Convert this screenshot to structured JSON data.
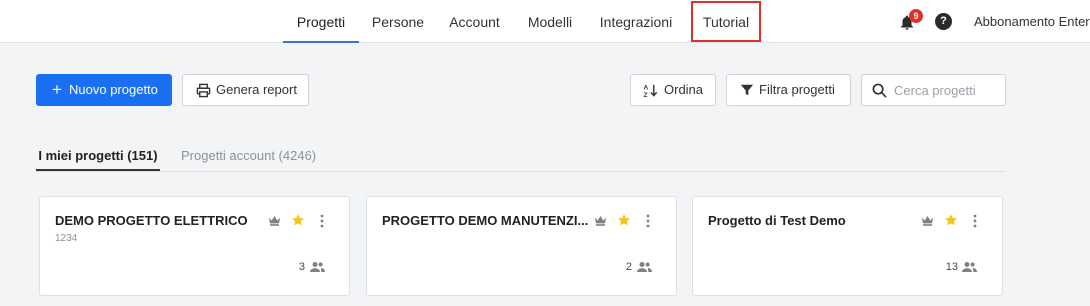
{
  "nav": {
    "items": [
      {
        "label": "Progetti",
        "active": true
      },
      {
        "label": "Persone",
        "active": false
      },
      {
        "label": "Account",
        "active": false
      },
      {
        "label": "Modelli",
        "active": false
      },
      {
        "label": "Integrazioni",
        "active": false
      },
      {
        "label": "Tutorial",
        "active": false,
        "highlighted": true
      }
    ],
    "notifications_count": "9",
    "help_label": "?",
    "subscription_label": "Abbonamento Enter"
  },
  "toolbar": {
    "new_project_label": "Nuovo progetto",
    "report_label": "Genera report",
    "sort_label": "Ordina",
    "filter_label": "Filtra progetti",
    "search_placeholder": "Cerca progetti"
  },
  "tabs": [
    {
      "label": "I miei progetti (151)",
      "active": true
    },
    {
      "label": "Progetti account (4246)",
      "active": false
    }
  ],
  "projects": [
    {
      "title": "DEMO PROGETTO ELETTRICO",
      "code": "1234",
      "members": "3",
      "starred": true
    },
    {
      "title": "PROGETTO DEMO MANUTENZI...",
      "code": "",
      "members": "2",
      "starred": true
    },
    {
      "title": "Progetto di Test Demo",
      "code": "",
      "members": "13",
      "starred": true
    }
  ],
  "colors": {
    "primary": "#1b6ff2",
    "active_tab_underline": "#3b6fd8",
    "highlight": "#e1302a",
    "star": "#f5c518"
  }
}
